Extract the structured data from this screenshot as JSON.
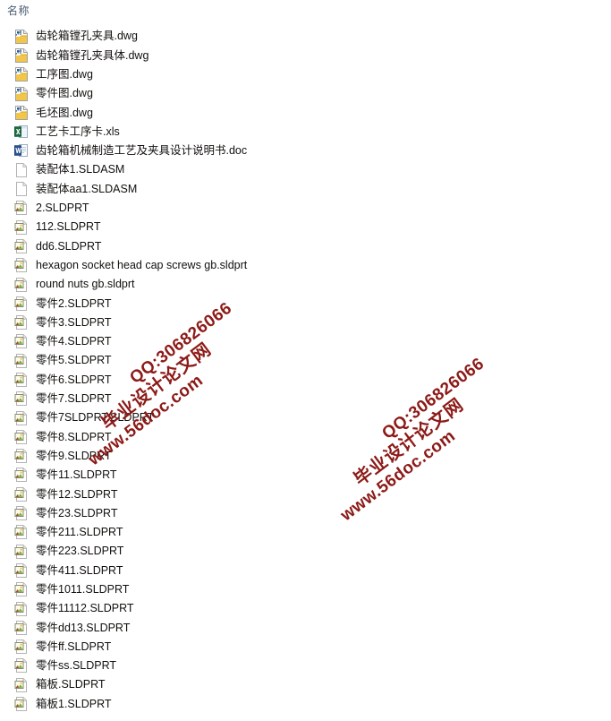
{
  "column_header": {
    "label": "名称"
  },
  "colors": {
    "header_text": "#4a5c70",
    "file_text": "#12100d",
    "watermark": "#8c1a17",
    "dwg_accent": "#e8b830",
    "excel_accent": "#1d7044",
    "word_accent": "#2a5699",
    "page_white": "#fdfdfd",
    "page_border": "#a6a6a6"
  },
  "files": [
    {
      "name": "齿轮箱镗孔夹具.dwg",
      "icon": "dwg-file-icon"
    },
    {
      "name": "齿轮箱镗孔夹具体.dwg",
      "icon": "dwg-file-icon"
    },
    {
      "name": "工序图.dwg",
      "icon": "dwg-file-icon"
    },
    {
      "name": "零件图.dwg",
      "icon": "dwg-file-icon"
    },
    {
      "name": "毛坯图.dwg",
      "icon": "dwg-file-icon"
    },
    {
      "name": "工艺卡工序卡.xls",
      "icon": "excel-file-icon"
    },
    {
      "name": "齿轮箱机械制造工艺及夹具设计说明书.doc",
      "icon": "word-file-icon"
    },
    {
      "name": "装配体1.SLDASM",
      "icon": "blank-document-icon"
    },
    {
      "name": "装配体aa1.SLDASM",
      "icon": "blank-document-icon"
    },
    {
      "name": "2.SLDPRT",
      "icon": "sldprt-file-icon"
    },
    {
      "name": "112.SLDPRT",
      "icon": "sldprt-file-icon"
    },
    {
      "name": "dd6.SLDPRT",
      "icon": "sldprt-file-icon"
    },
    {
      "name": "hexagon socket head cap screws gb.sldprt",
      "icon": "sldprt-file-icon"
    },
    {
      "name": "round nuts gb.sldprt",
      "icon": "sldprt-file-icon"
    },
    {
      "name": "零件2.SLDPRT",
      "icon": "sldprt-file-icon"
    },
    {
      "name": "零件3.SLDPRT",
      "icon": "sldprt-file-icon"
    },
    {
      "name": "零件4.SLDPRT",
      "icon": "sldprt-file-icon"
    },
    {
      "name": "零件5.SLDPRT",
      "icon": "sldprt-file-icon"
    },
    {
      "name": "零件6.SLDPRT",
      "icon": "sldprt-file-icon"
    },
    {
      "name": "零件7.SLDPRT",
      "icon": "sldprt-file-icon"
    },
    {
      "name": "零件7SLDPRT.SLDPRT",
      "icon": "sldprt-file-icon"
    },
    {
      "name": "零件8.SLDPRT",
      "icon": "sldprt-file-icon"
    },
    {
      "name": "零件9.SLDPRT",
      "icon": "sldprt-file-icon"
    },
    {
      "name": "零件11.SLDPRT",
      "icon": "sldprt-file-icon"
    },
    {
      "name": "零件12.SLDPRT",
      "icon": "sldprt-file-icon"
    },
    {
      "name": "零件23.SLDPRT",
      "icon": "sldprt-file-icon"
    },
    {
      "name": "零件211.SLDPRT",
      "icon": "sldprt-file-icon"
    },
    {
      "name": "零件223.SLDPRT",
      "icon": "sldprt-file-icon"
    },
    {
      "name": "零件411.SLDPRT",
      "icon": "sldprt-file-icon"
    },
    {
      "name": "零件1011.SLDPRT",
      "icon": "sldprt-file-icon"
    },
    {
      "name": "零件11112.SLDPRT",
      "icon": "sldprt-file-icon"
    },
    {
      "name": "零件dd13.SLDPRT",
      "icon": "sldprt-file-icon"
    },
    {
      "name": "零件ff.SLDPRT",
      "icon": "sldprt-file-icon"
    },
    {
      "name": "零件ss.SLDPRT",
      "icon": "sldprt-file-icon"
    },
    {
      "name": "箱板.SLDPRT",
      "icon": "sldprt-file-icon"
    },
    {
      "name": "箱板1.SLDPRT",
      "icon": "sldprt-file-icon"
    }
  ],
  "watermarks": [
    {
      "url": "www.56doc.com",
      "site": "毕业设计论文网",
      "qq": "QQ:306826066"
    },
    {
      "url": "www.56doc.com",
      "site": "毕业设计论文网",
      "qq": "QQ:306826066"
    }
  ]
}
